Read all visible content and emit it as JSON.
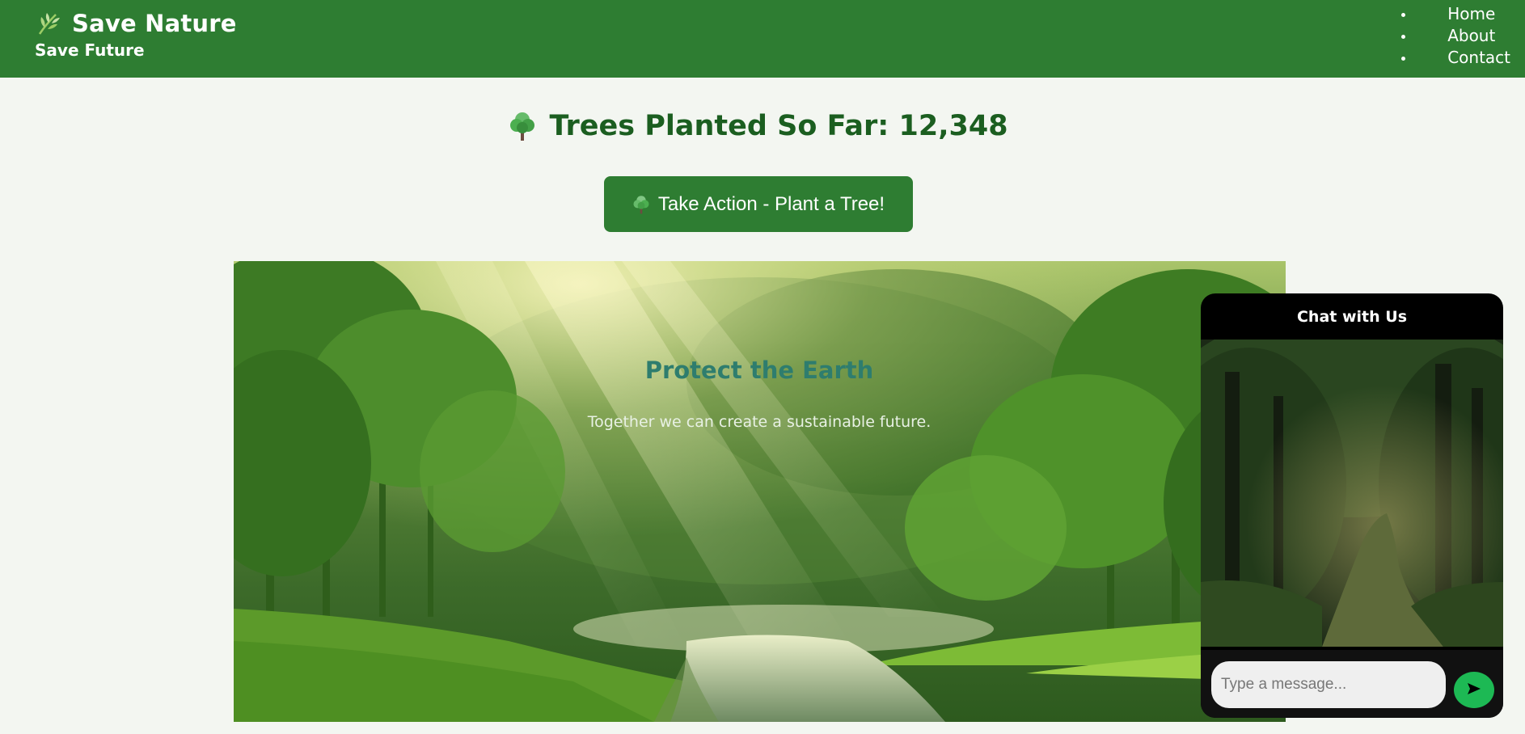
{
  "header": {
    "title": "Save Nature",
    "subtitle": "Save Future",
    "logo_icon": "leaf-icon",
    "nav": [
      {
        "label": "Home"
      },
      {
        "label": "About"
      },
      {
        "label": "Contact"
      }
    ]
  },
  "counter": {
    "icon": "tree-icon",
    "text": "Trees Planted So Far: 12,348"
  },
  "cta": {
    "icon": "tree-icon",
    "label": "Take Action - Plant a Tree!"
  },
  "hero": {
    "title": "Protect the Earth",
    "text": "Together we can create a sustainable future."
  },
  "chat": {
    "title": "Chat with Us",
    "input_placeholder": "Type a message...",
    "input_value": "",
    "send_icon": "send-arrow-icon"
  },
  "colors": {
    "header_bg": "#2e7d32",
    "page_bg": "#f3f6f1",
    "counter_text": "#1b5e20",
    "hero_title": "#2e7d6e",
    "send_button": "#1db954",
    "chat_bg": "#000000"
  }
}
